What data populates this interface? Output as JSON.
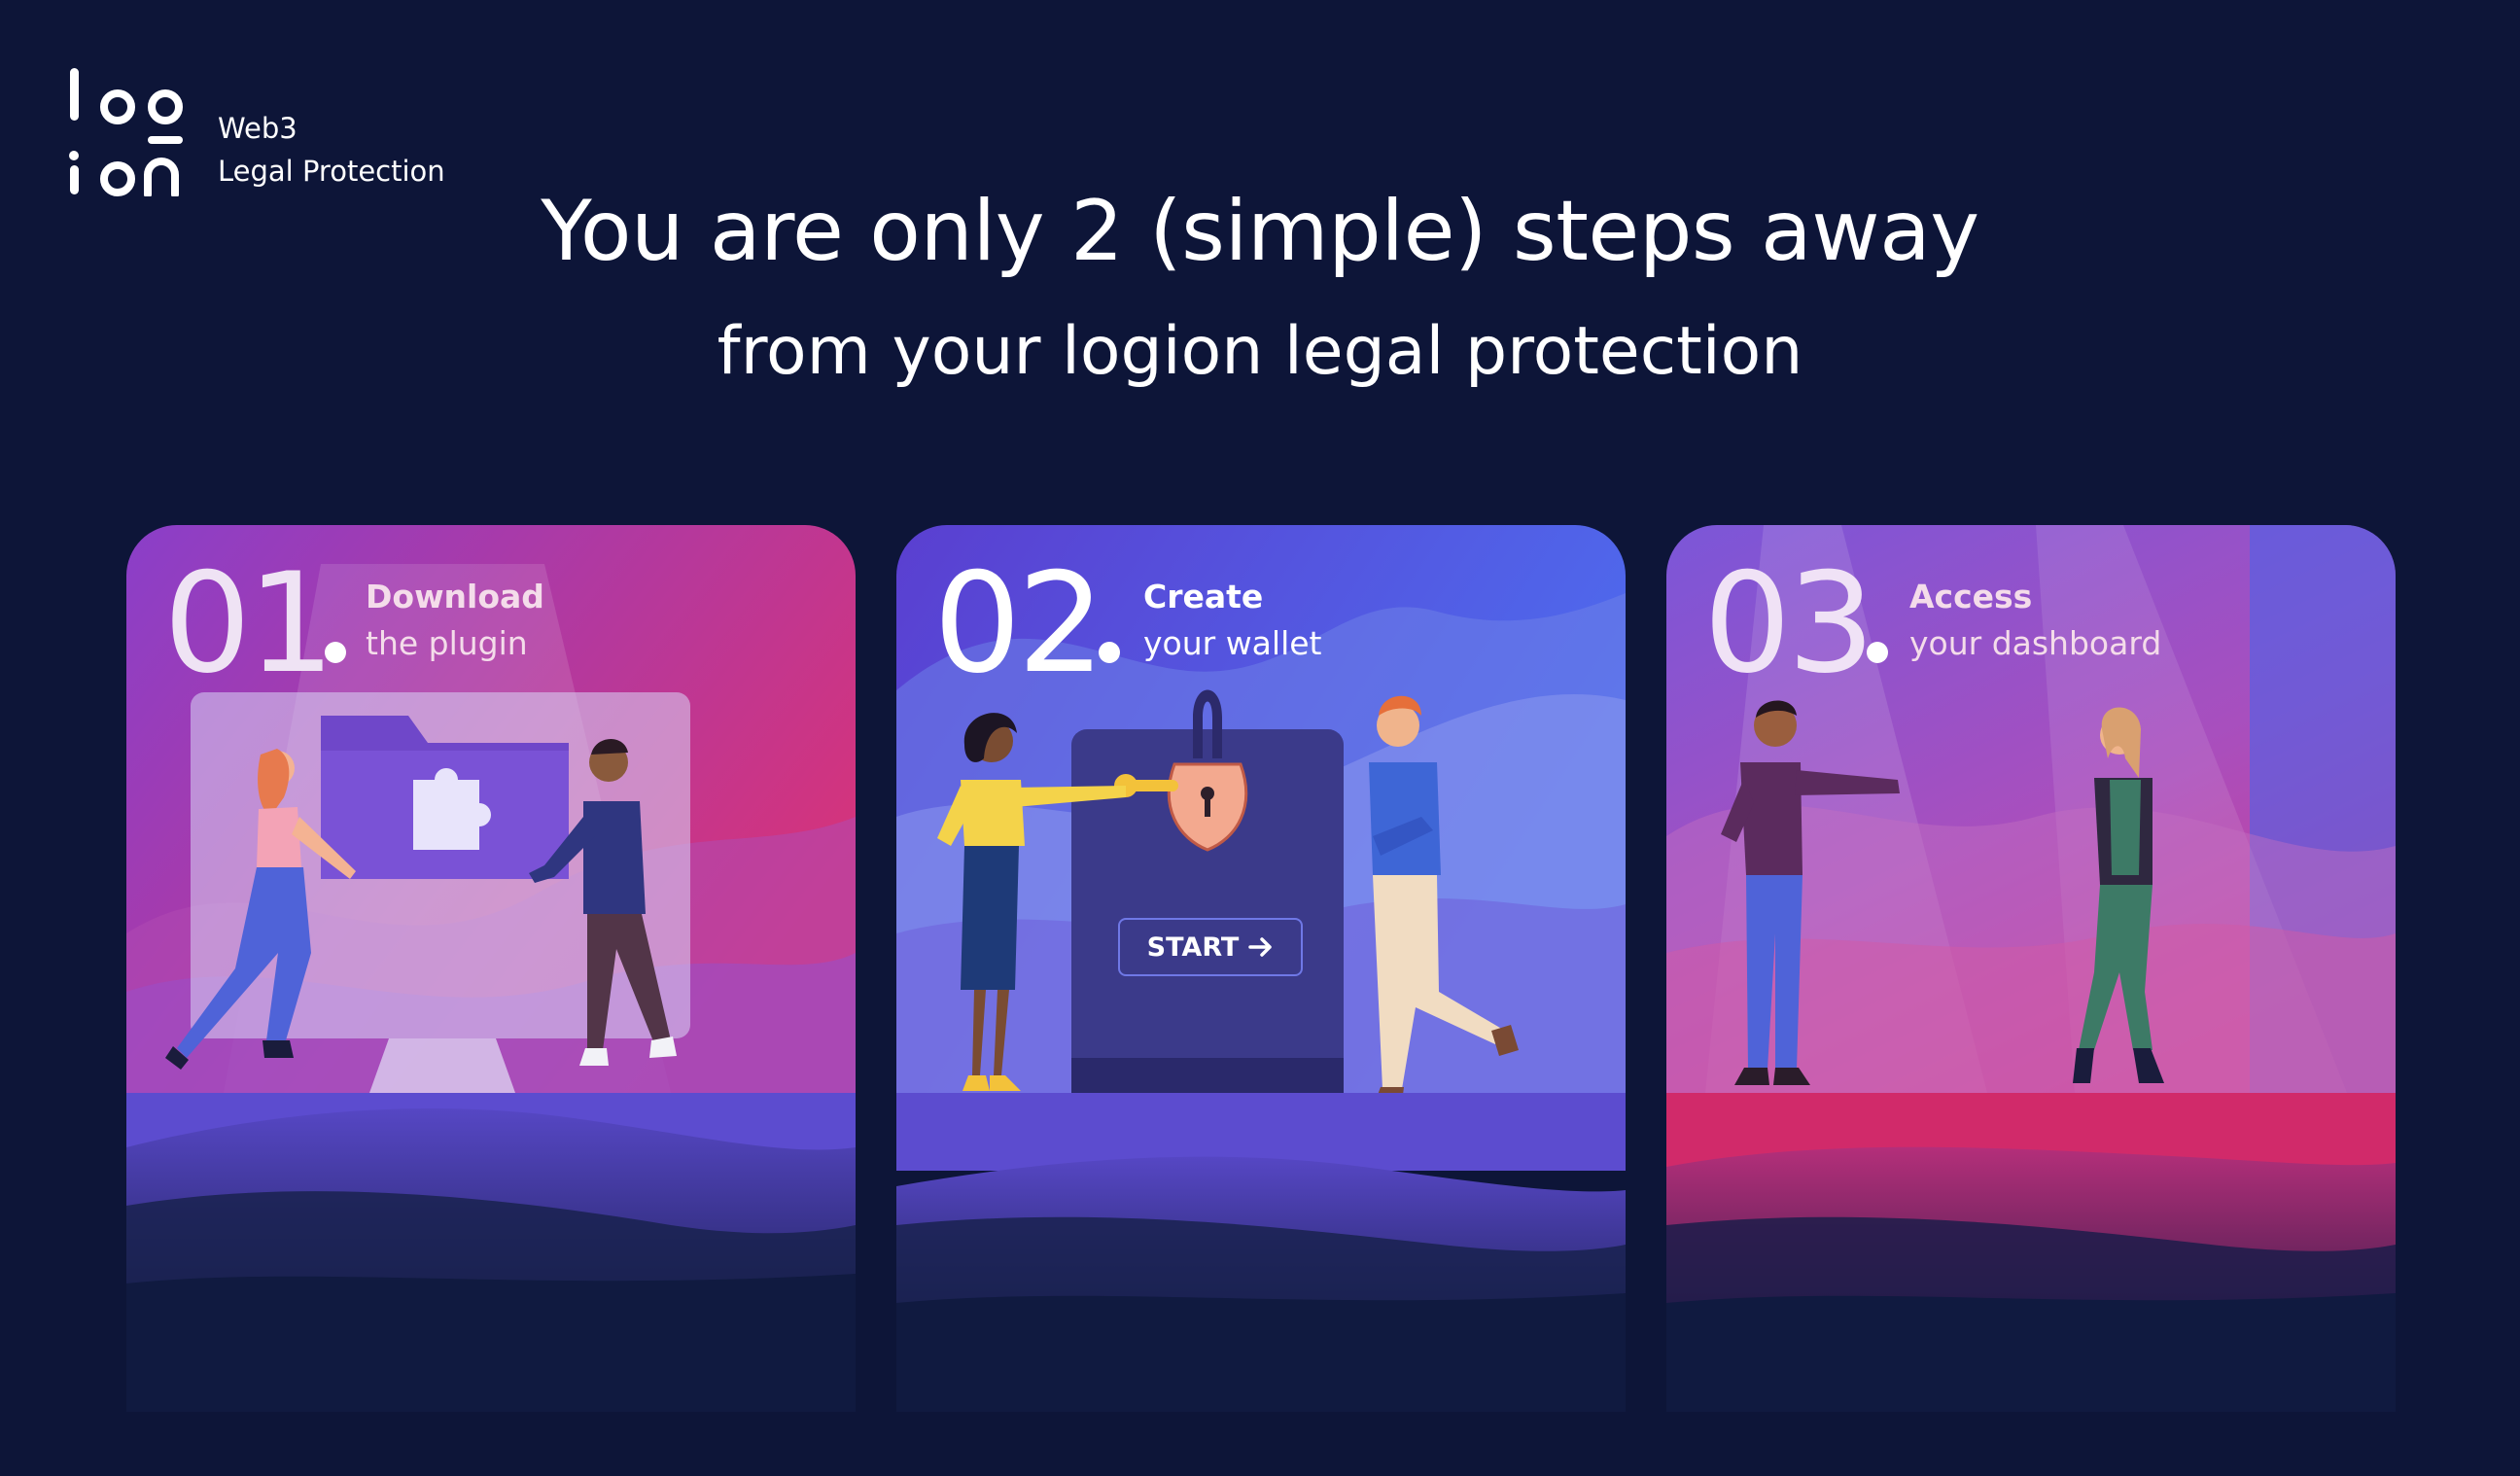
{
  "brand": {
    "line1": "Web3",
    "line2": "Legal Protection",
    "logo_icon": "logion-logo"
  },
  "headline": "You are only 2 (simple) steps away",
  "subheadline": "from your logion legal protection",
  "steps": [
    {
      "number": "01",
      "title": "Download",
      "subtitle": "the plugin",
      "icon": "puzzle-folder-icon"
    },
    {
      "number": "02",
      "title": "Create",
      "subtitle": "your wallet",
      "button_label": "START",
      "icon": "padlock-icon"
    },
    {
      "number": "03",
      "title": "Access",
      "subtitle": "your dashboard"
    }
  ],
  "colors": {
    "background": "#0d1538",
    "card1_accent": "#c2357a",
    "card2_accent": "#4b63e6",
    "card3_accent": "#d02d6d",
    "floor_blue": "#5c4ccf",
    "floor_pink": "#d12a6a"
  }
}
